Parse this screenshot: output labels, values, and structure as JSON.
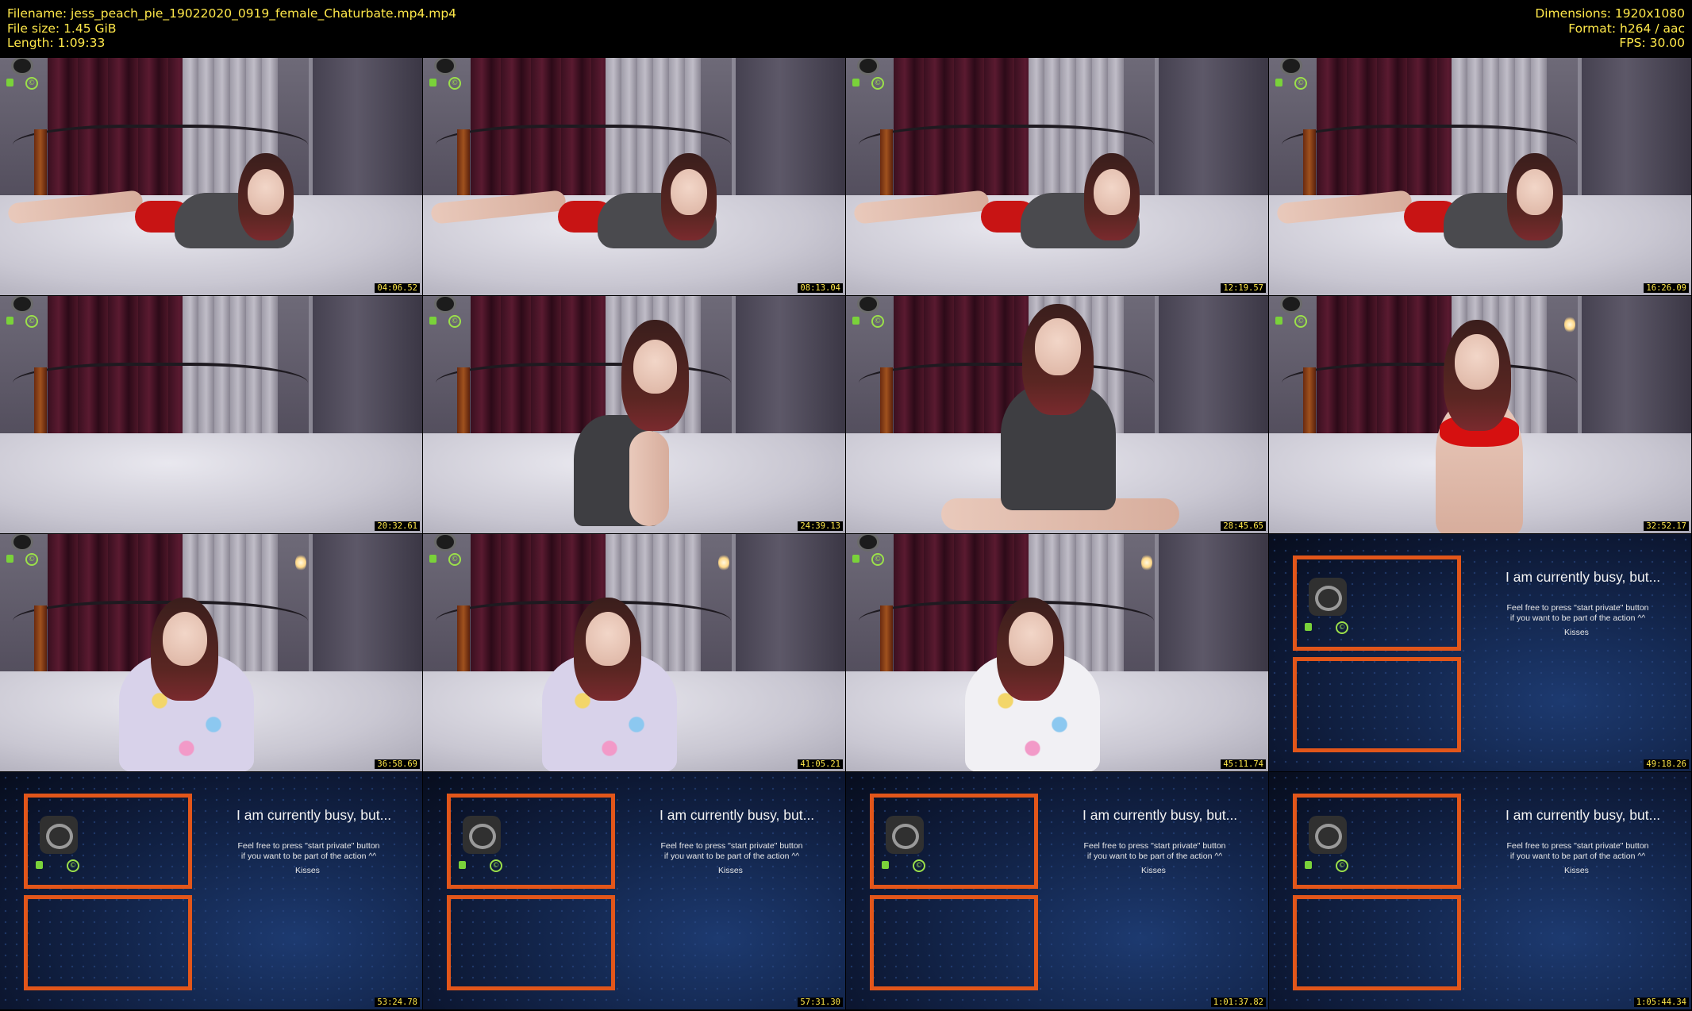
{
  "meta": {
    "filename": "Filename: jess_peach_pie_19022020_0919_female_Chaturbate.mp4.mp4",
    "filesize": "File size: 1.45 GiB",
    "length": "Length: 1:09:33",
    "dimensions": "Dimensions: 1920x1080",
    "format": "Format: h264 / aac",
    "fps": "FPS: 30.00"
  },
  "thumbnails": [
    {
      "time": "04:06.52",
      "scene": "lying"
    },
    {
      "time": "08:13.04",
      "scene": "lying"
    },
    {
      "time": "12:19.57",
      "scene": "lying"
    },
    {
      "time": "16:26.09",
      "scene": "lying"
    },
    {
      "time": "20:32.61",
      "scene": "empty"
    },
    {
      "time": "24:39.13",
      "scene": "kneeling"
    },
    {
      "time": "28:45.65",
      "scene": "sitting-sweater"
    },
    {
      "time": "32:52.17",
      "scene": "red-top"
    },
    {
      "time": "36:58.69",
      "scene": "onesie"
    },
    {
      "time": "41:05.21",
      "scene": "onesie"
    },
    {
      "time": "45:11.74",
      "scene": "onesie-white"
    },
    {
      "time": "49:18.26",
      "scene": "busy"
    },
    {
      "time": "53:24.78",
      "scene": "busy"
    },
    {
      "time": "57:31.30",
      "scene": "busy"
    },
    {
      "time": "1:01:37.82",
      "scene": "busy"
    },
    {
      "time": "1:05:44.34",
      "scene": "busy"
    }
  ],
  "busy_screen": {
    "title": "I am currently busy, but...",
    "line1": "Feel free to press \"start private\" button",
    "line2": "if you want to be part of the action ^^",
    "sign": "Kisses"
  },
  "colors": {
    "meta_text": "#ffe84a",
    "timestamp_text": "#ffe84a",
    "frame_orange": "#e2561a"
  }
}
